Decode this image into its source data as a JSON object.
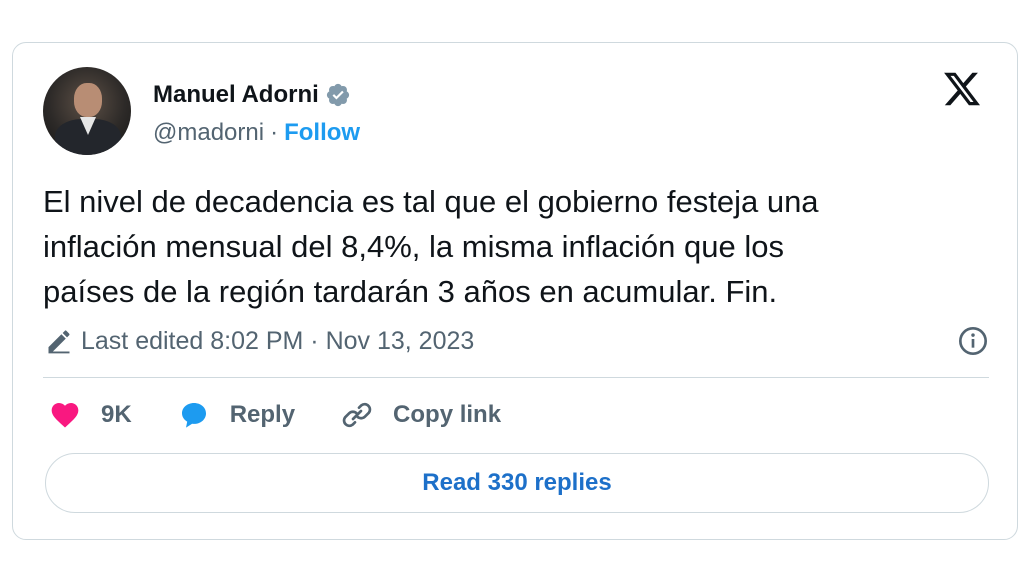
{
  "author": {
    "name": "Manuel Adorni",
    "handle": "@madorni",
    "separator": "·",
    "follow_label": "Follow"
  },
  "tweet": {
    "text_lines": [
      "El nivel de decadencia es tal que el gobierno festeja una",
      "inflación mensual del 8,4%, la misma inflación que los",
      "países de la región tardarán 3 años en acumular. Fin."
    ],
    "edited_label": "Last edited 8:02 PM · Nov 13, 2023"
  },
  "actions": {
    "like_count": "9K",
    "reply_label": "Reply",
    "copy_link_label": "Copy link"
  },
  "read_replies_label": "Read 330 replies",
  "icons": {
    "verified": "verified-badge-icon",
    "brand": "x-logo-icon",
    "edit": "pencil-icon",
    "info": "info-icon",
    "like": "heart-icon",
    "reply": "speech-bubble-icon",
    "link": "link-icon"
  },
  "colors": {
    "accent": "#1d9bf0",
    "like": "#f91880",
    "muted": "#536471",
    "text": "#0f1419",
    "border": "#cfd9de"
  }
}
